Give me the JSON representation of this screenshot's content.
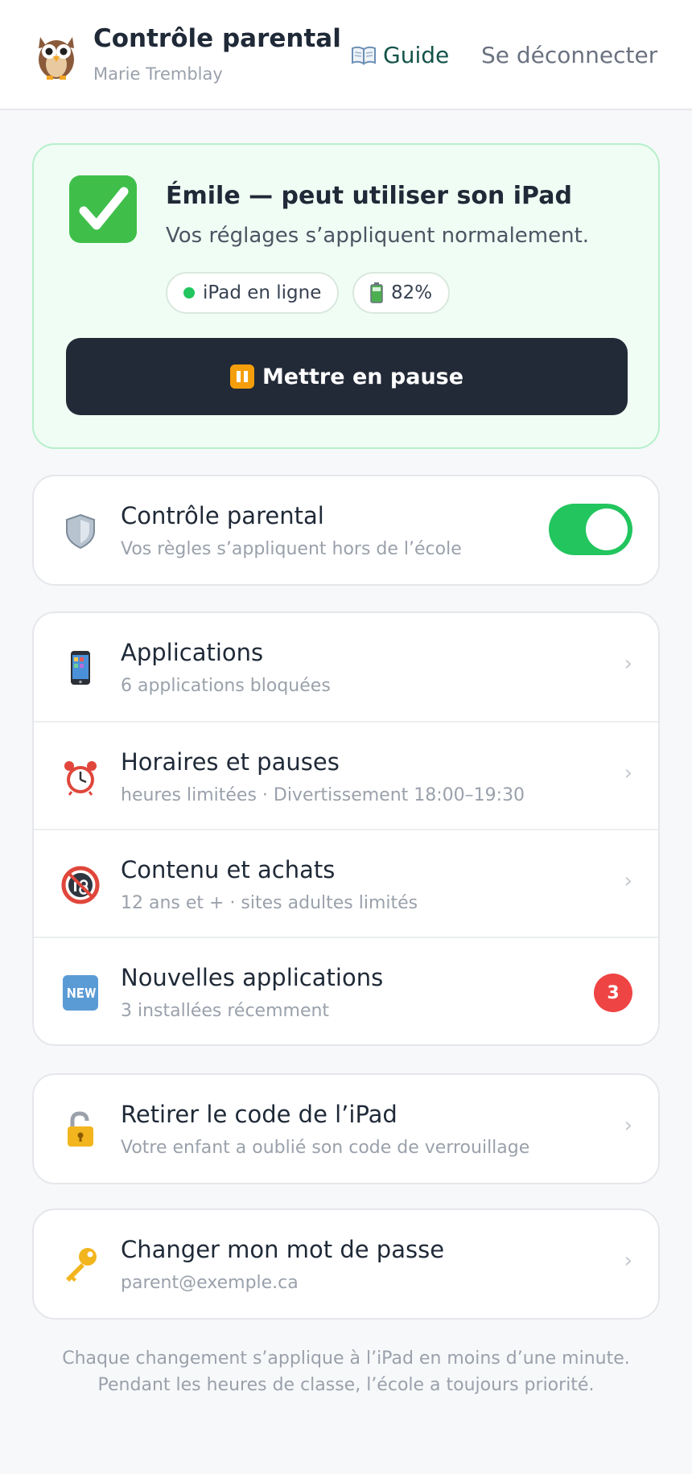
{
  "header": {
    "title": "Contrôle parental",
    "user": "Marie Tremblay",
    "guide_label": "Guide",
    "logout_label": "Se déconnecter"
  },
  "status": {
    "title": "Émile — peut utiliser son iPad",
    "subtitle": "Vos réglages s’appliquent normalement.",
    "online_label": "iPad en ligne",
    "battery_label": "82%",
    "pause_label": "Mettre en pause"
  },
  "control": {
    "title": "Contrôle parental",
    "subtitle": "Vos règles s’appliquent hors de l’école",
    "enabled": true
  },
  "settings": [
    {
      "title": "Applications",
      "subtitle": "6 applications bloquées",
      "icon": "phone-icon"
    },
    {
      "title": "Horaires et pauses",
      "subtitle": "heures limitées · Divertissement 18:00–19:30",
      "icon": "alarm-clock-icon"
    },
    {
      "title": "Contenu et achats",
      "subtitle": "12 ans et + · sites adultes limités",
      "icon": "no-under-18-icon"
    },
    {
      "title": "Nouvelles applications",
      "subtitle": "3 installées récemment",
      "icon": "new-icon",
      "badge": "3"
    }
  ],
  "unlock": {
    "title": "Retirer le code de l’iPad",
    "subtitle": "Votre enfant a oublié son code de verrouillage"
  },
  "password": {
    "title": "Changer mon mot de passe",
    "subtitle": "parent@exemple.ca"
  },
  "footer": {
    "line1": "Chaque changement s’applique à l’iPad en moins d’une minute.",
    "line2": "Pendant les heures de classe, l’école a toujours priorité."
  },
  "colors": {
    "accent_green": "#22c55e",
    "dark_button": "#222a37",
    "badge_red": "#ef4444",
    "guide_link": "#14534a"
  }
}
